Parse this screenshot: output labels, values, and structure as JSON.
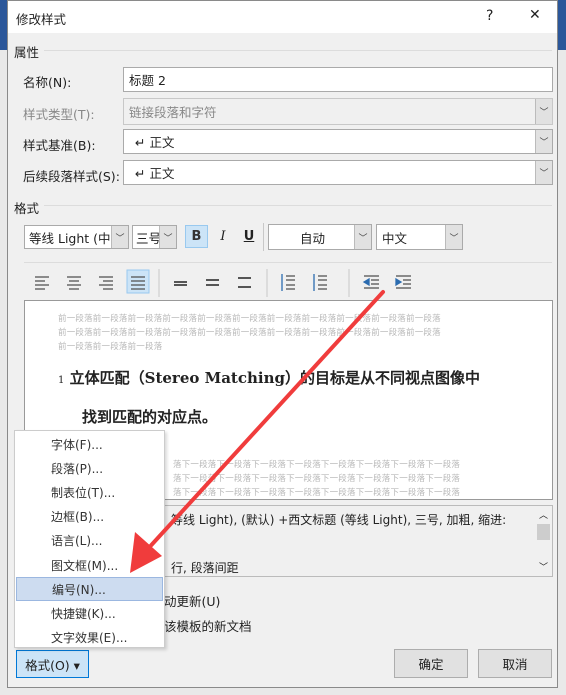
{
  "dialog": {
    "title": "修改样式",
    "help": "?",
    "close": "✕"
  },
  "properties": {
    "section": "属性",
    "name_label": "名称(N):",
    "name_value": "标题 2",
    "type_label": "样式类型(T):",
    "type_value": "链接段落和字符",
    "based_label": "样式基准(B):",
    "based_value": "↵ 正文",
    "next_label": "后续段落样式(S):",
    "next_value": "↵ 正文"
  },
  "format": {
    "section": "格式",
    "font": "等线 Light (中文",
    "size": "三号",
    "bold": "B",
    "italic": "I",
    "underline": "U",
    "color": "自动",
    "lang": "中文"
  },
  "preview": {
    "prev_text": [
      "前一段落前一段落前一段落前一段落前一段落前一段落前一段落前一段落前一段落前一段落前一段落",
      "前一段落前一段落前一段落前一段落前一段落前一段落前一段落前一段落前一段落前一段落前一段落",
      "前一段落前一段落前一段落"
    ],
    "number": "1",
    "heading_line1": "立体匹配（Stereo Matching）的目标是从不同视点图像中",
    "heading_line2": "找到匹配的对应点。",
    "next_text": [
      "落下一段落下一段落下一段落下一段落下一段落下一段落下一段落下一段落",
      "落下一段落下一段落下一段落下一段落下一段落下一段落下一段落下一段落",
      "落下一段落下一段落下一段落下一段落下一段落下一段落下一段落下一段落"
    ]
  },
  "description": {
    "line1": "等线 Light), (默认) +西文标题 (等线 Light), 三号, 加粗, 缩进:",
    "line2": "行, 段落间距"
  },
  "options": {
    "auto_update": "动更新(U)",
    "new_docs": "该模板的新文档"
  },
  "menu": {
    "items": [
      {
        "label": "字体(F)..."
      },
      {
        "label": "段落(P)..."
      },
      {
        "label": "制表位(T)..."
      },
      {
        "label": "边框(B)..."
      },
      {
        "label": "语言(L)..."
      },
      {
        "label": "图文框(M)..."
      },
      {
        "label": "编号(N)..."
      },
      {
        "label": "快捷键(K)..."
      },
      {
        "label": "文字效果(E)..."
      }
    ],
    "highlighted": "编号(N)..."
  },
  "buttons": {
    "format": "格式(O) ▾",
    "ok": "确定",
    "cancel": "取消"
  },
  "colors": {
    "accent": "#cce4f7",
    "arrow": "#f03c3c",
    "background_blue": "#2b579a"
  }
}
